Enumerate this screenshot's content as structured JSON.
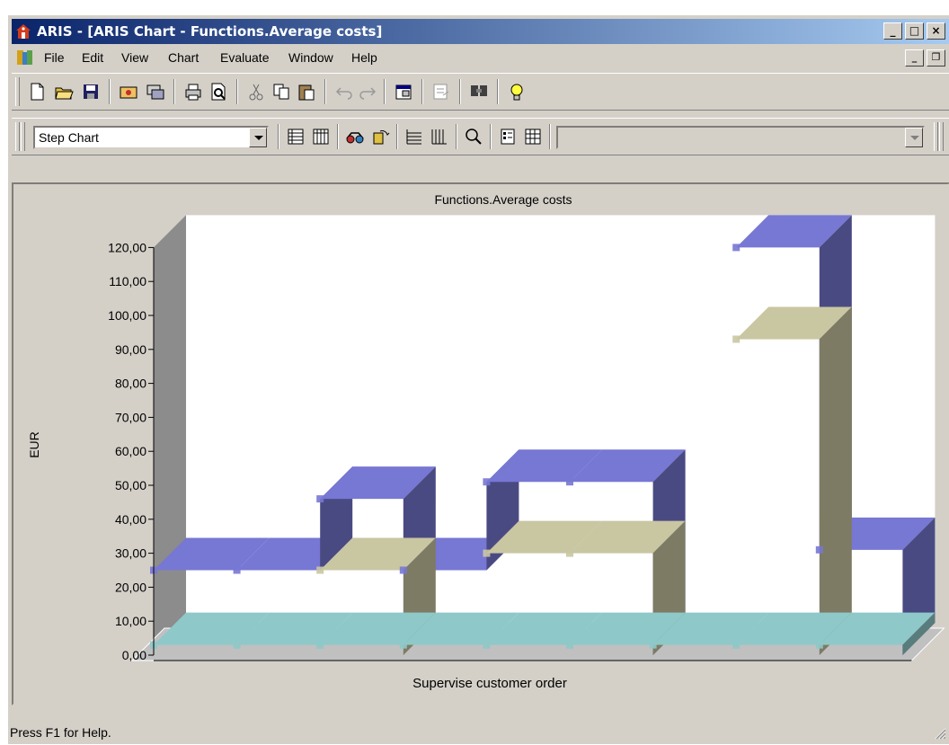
{
  "window": {
    "title": "ARIS - [ARIS Chart - Functions.Average costs]",
    "min_glyph": "_",
    "max_glyph": "□",
    "close_glyph": "×",
    "restore_glyph": "❐"
  },
  "menu": {
    "items": [
      "File",
      "Edit",
      "View",
      "Chart",
      "Evaluate",
      "Window",
      "Help"
    ]
  },
  "toolbar2": {
    "chart_type_value": "Step Chart",
    "secondary_combo_value": ""
  },
  "colors": {
    "title_gradient_start": "#0a246a",
    "title_gradient_end": "#a6caf0",
    "series_blue_top": "#7777d4",
    "series_blue_side": "#4a4a94",
    "series_khaki_top": "#c9c6a2",
    "series_khaki_side": "#8e8c6c",
    "series_maroon": "#7a2040",
    "series_teal": "#8fc8c8"
  },
  "chart_data": {
    "type": "step",
    "title": "Functions.Average costs",
    "xlabel": "Supervise customer order",
    "ylabel": "EUR",
    "ylim": [
      0,
      120
    ],
    "y_ticks": [
      "0,00",
      "10,00",
      "20,00",
      "30,00",
      "40,00",
      "50,00",
      "60,00",
      "70,00",
      "80,00",
      "90,00",
      "100,00",
      "110,00",
      "120,00"
    ],
    "series": [
      {
        "color": "#7777d4",
        "values": [
          25,
          25,
          46,
          25,
          51,
          51,
          0,
          120,
          31
        ]
      },
      {
        "color": "#c9c6a2",
        "values": [
          0,
          0,
          25,
          0,
          30,
          30,
          0,
          93,
          0
        ]
      },
      {
        "color": "#7a2040",
        "values": [
          0,
          0,
          0,
          0,
          0,
          0,
          0,
          0,
          0
        ]
      },
      {
        "color": "#8fc8c8",
        "values": [
          3,
          3,
          3,
          3,
          3,
          3,
          3,
          3,
          3
        ]
      }
    ]
  },
  "status": {
    "text": "Press F1 for Help."
  }
}
